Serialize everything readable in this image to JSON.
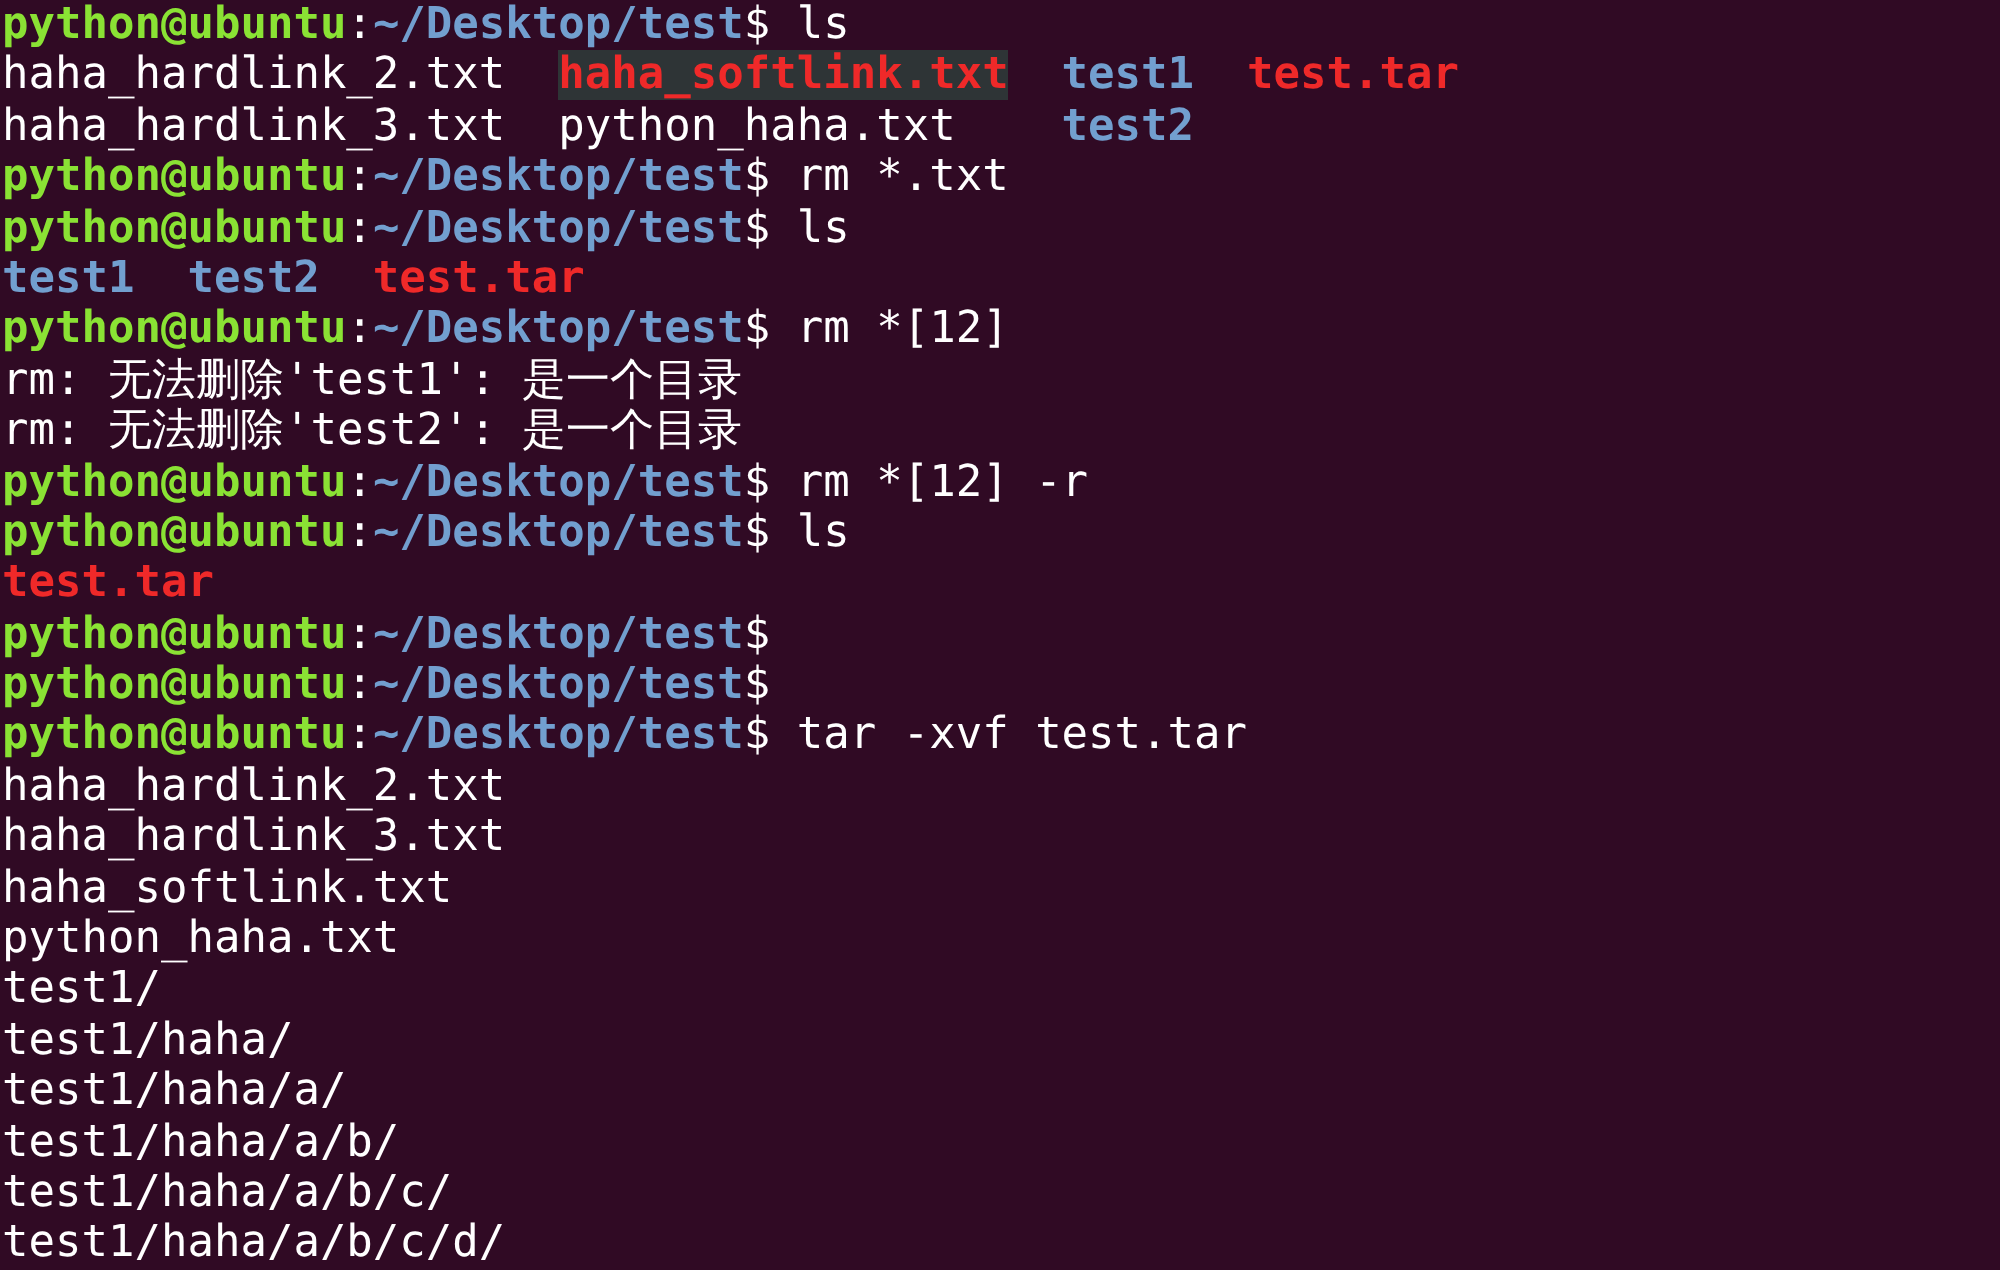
{
  "terminal": {
    "lines": [
      {
        "kind": "prompt",
        "user": "python@ubuntu",
        "sep": ":",
        "path": "~/Desktop/test",
        "symbol": "$",
        "command": "ls"
      },
      {
        "kind": "listing",
        "entries": [
          {
            "name": "haha_hardlink_2.txt",
            "kind": "file"
          },
          {
            "name": "haha_softlink.txt",
            "kind": "brokenlink"
          },
          {
            "name": "test1",
            "kind": "dir"
          },
          {
            "name": "test.tar",
            "kind": "archive"
          }
        ]
      },
      {
        "kind": "listing",
        "entries": [
          {
            "name": "haha_hardlink_3.txt",
            "kind": "file"
          },
          {
            "name": "python_haha.txt",
            "kind": "file"
          },
          {
            "name": "test2",
            "kind": "dir"
          }
        ]
      },
      {
        "kind": "prompt",
        "user": "python@ubuntu",
        "sep": ":",
        "path": "~/Desktop/test",
        "symbol": "$",
        "command": "rm *.txt"
      },
      {
        "kind": "prompt",
        "user": "python@ubuntu",
        "sep": ":",
        "path": "~/Desktop/test",
        "symbol": "$",
        "command": "ls"
      },
      {
        "kind": "listing",
        "entries": [
          {
            "name": "test1",
            "kind": "dir"
          },
          {
            "name": "test2",
            "kind": "dir"
          },
          {
            "name": "test.tar",
            "kind": "archive"
          }
        ]
      },
      {
        "kind": "prompt",
        "user": "python@ubuntu",
        "sep": ":",
        "path": "~/Desktop/test",
        "symbol": "$",
        "command": "rm *[12]"
      },
      {
        "kind": "output",
        "text": "rm: 无法删除'test1': 是一个目录"
      },
      {
        "kind": "output",
        "text": "rm: 无法删除'test2': 是一个目录"
      },
      {
        "kind": "prompt",
        "user": "python@ubuntu",
        "sep": ":",
        "path": "~/Desktop/test",
        "symbol": "$",
        "command": "rm *[12] -r"
      },
      {
        "kind": "prompt",
        "user": "python@ubuntu",
        "sep": ":",
        "path": "~/Desktop/test",
        "symbol": "$",
        "command": "ls"
      },
      {
        "kind": "listing",
        "entries": [
          {
            "name": "test.tar",
            "kind": "archive"
          }
        ]
      },
      {
        "kind": "prompt",
        "user": "python@ubuntu",
        "sep": ":",
        "path": "~/Desktop/test",
        "symbol": "$"
      },
      {
        "kind": "prompt",
        "user": "python@ubuntu",
        "sep": ":",
        "path": "~/Desktop/test",
        "symbol": "$"
      },
      {
        "kind": "prompt",
        "user": "python@ubuntu",
        "sep": ":",
        "path": "~/Desktop/test",
        "symbol": "$",
        "command": "tar -xvf test.tar"
      },
      {
        "kind": "output",
        "text": "haha_hardlink_2.txt"
      },
      {
        "kind": "output",
        "text": "haha_hardlink_3.txt"
      },
      {
        "kind": "output",
        "text": "haha_softlink.txt"
      },
      {
        "kind": "output",
        "text": "python_haha.txt"
      },
      {
        "kind": "output",
        "text": "test1/"
      },
      {
        "kind": "output",
        "text": "test1/haha/"
      },
      {
        "kind": "output",
        "text": "test1/haha/a/"
      },
      {
        "kind": "output",
        "text": "test1/haha/a/b/"
      },
      {
        "kind": "output",
        "text": "test1/haha/a/b/c/"
      },
      {
        "kind": "output",
        "text": "test1/haha/a/b/c/d/"
      }
    ]
  }
}
